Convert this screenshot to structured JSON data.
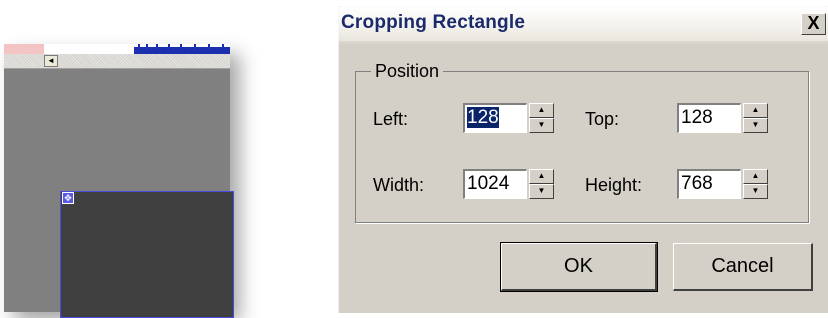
{
  "background_window": {
    "scroll_left_arrow": "◄",
    "move_handle_glyph": "✥"
  },
  "dialog": {
    "title": "Cropping Rectangle",
    "close_label": "X",
    "position_group": {
      "label": "Position",
      "left_label": "Left:",
      "left_value": "128",
      "top_label": "Top:",
      "top_value": "128",
      "width_label": "Width:",
      "width_value": "1024",
      "height_label": "Height:",
      "height_value": "768"
    },
    "spin_up": "▲",
    "spin_down": "▼",
    "ok_label": "OK",
    "cancel_label": "Cancel"
  },
  "colors": {
    "selection": "#0a246a",
    "dialog_face": "#d4d0c8",
    "title_text": "#1a2a6a",
    "crop_border": "#4b4be0"
  }
}
